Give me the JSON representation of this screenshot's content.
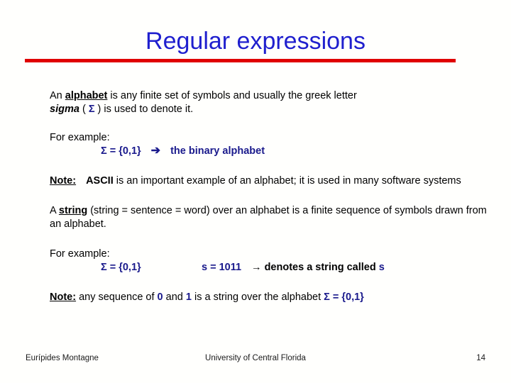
{
  "slide": {
    "title": "Regular expressions",
    "title_color": "#1f1fce",
    "rule_color": "#e00000",
    "accent_blue": "#1a1a8c",
    "background": "#fffffd"
  },
  "content": {
    "p1": {
      "lead": "An ",
      "term": "alphabet",
      "mid": " is any finite set of symbols and usually the greek letter ",
      "term2": "sigma",
      "paren_open": " ( ",
      "sigma": "Σ",
      "paren_close": " ) ",
      "tail": "is used to denote it."
    },
    "p2": {
      "label": "For example:",
      "sigma_def": "Σ = {0,1}",
      "arrow": "➔",
      "result": "the binary alphabet"
    },
    "p3": {
      "note": "Note:",
      "ascii": "ASCII",
      "text": " is an important example of an alphabet; it is used in many software systems"
    },
    "p4": {
      "lead": "A ",
      "term": "string",
      "tail": " (string = sentence = word) over an alphabet is a finite sequence of symbols drawn from an alphabet."
    },
    "p5": {
      "label": "For example:",
      "sigma_def": "Σ = {0,1}",
      "string_def": "s = 1011",
      "arrow": "→",
      "denotes": " denotes a string called ",
      "string_name": "s"
    },
    "p6": {
      "note": "Note:",
      "t1": " any sequence of  ",
      "zero": "0",
      "t2": " and ",
      "one": "1",
      "t3": " is a string over the alphabet ",
      "sigma_def": "Σ = {0,1}"
    }
  },
  "footer": {
    "author": "Eurípides Montagne",
    "institution": "University of Central Florida",
    "page_number": "14"
  }
}
